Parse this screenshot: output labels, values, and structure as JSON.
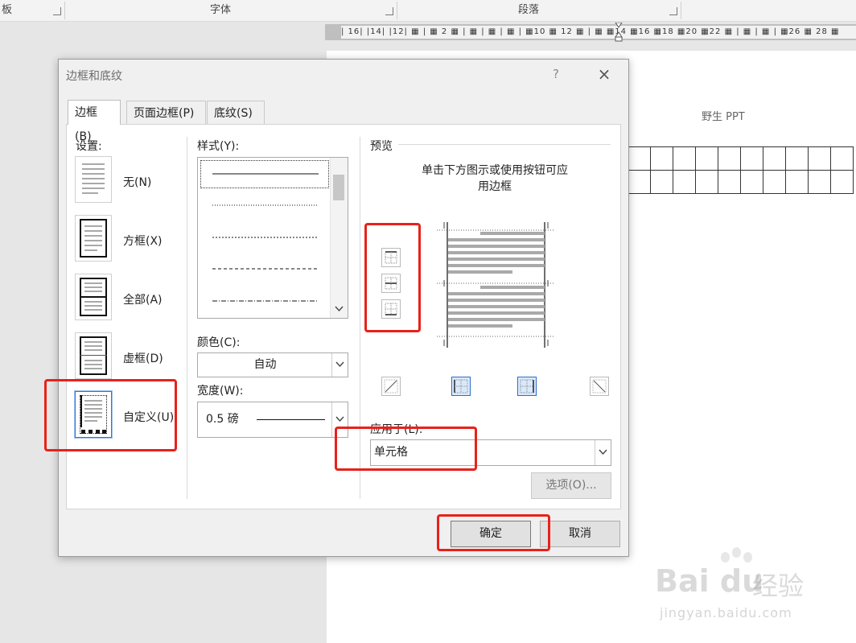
{
  "ribbon": {
    "group_clip": "板",
    "group_font": "字体",
    "group_paragraph": "段落"
  },
  "ruler": {
    "ticks": "| 16| |14| |12| ▦ | ▦ 2 ▦ | ▦ | ▦ | ▦ | ▦10 ▦ 12 ▦ | ▦ ▦14 ▦16 ▦18 ▦20 ▦22 ▦ | ▦ | ▦ | ▦26 ▦ 28 ▦"
  },
  "document": {
    "title": "野生 PPT"
  },
  "watermark": {
    "logo": "Bai du",
    "logo_cn": "经验",
    "url": "jingyan.baidu.com"
  },
  "dialog": {
    "title": "边框和底纹",
    "help": "?",
    "close": "×",
    "tabs": [
      "边框(B)",
      "页面边框(P)",
      "底纹(S)"
    ],
    "settings_label": "设置:",
    "settings": [
      "无(N)",
      "方框(X)",
      "全部(A)",
      "虚框(D)",
      "自定义(U)"
    ],
    "style_label": "样式(Y):",
    "color_label": "颜色(C):",
    "color_value": "自动",
    "width_label": "宽度(W):",
    "width_value": "0.5 磅",
    "preview_label": "预览",
    "preview_hint_1": "单击下方图示或使用按钮可应",
    "preview_hint_2": "用边框",
    "apply_label": "应用于(L):",
    "apply_value": "单元格",
    "options_button": "选项(O)...",
    "ok_button": "确定",
    "cancel_button": "取消"
  },
  "colors": {
    "highlight": "#e8211b",
    "selection": "#2b78d6"
  }
}
